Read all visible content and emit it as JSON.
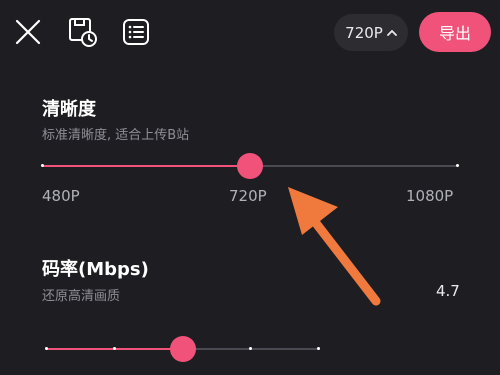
{
  "topbar": {
    "icons": [
      "close-icon",
      "save-clock-icon",
      "list-icon"
    ],
    "resolution_selector": "720P",
    "export_label": "导出"
  },
  "resolution": {
    "title": "清晰度",
    "subtitle": "标准清晰度, 适合上传B站",
    "value_fraction": 0.5,
    "ticks": [
      "480P",
      "720P",
      "1080P"
    ]
  },
  "bitrate": {
    "title": "码率(Mbps)",
    "subtitle": "还原高清画质",
    "value": "4.7",
    "value_fraction": 0.5
  },
  "colors": {
    "accent": "#f0527a",
    "background": "#1e1e22",
    "annotation_arrow": "#f07a3e"
  }
}
